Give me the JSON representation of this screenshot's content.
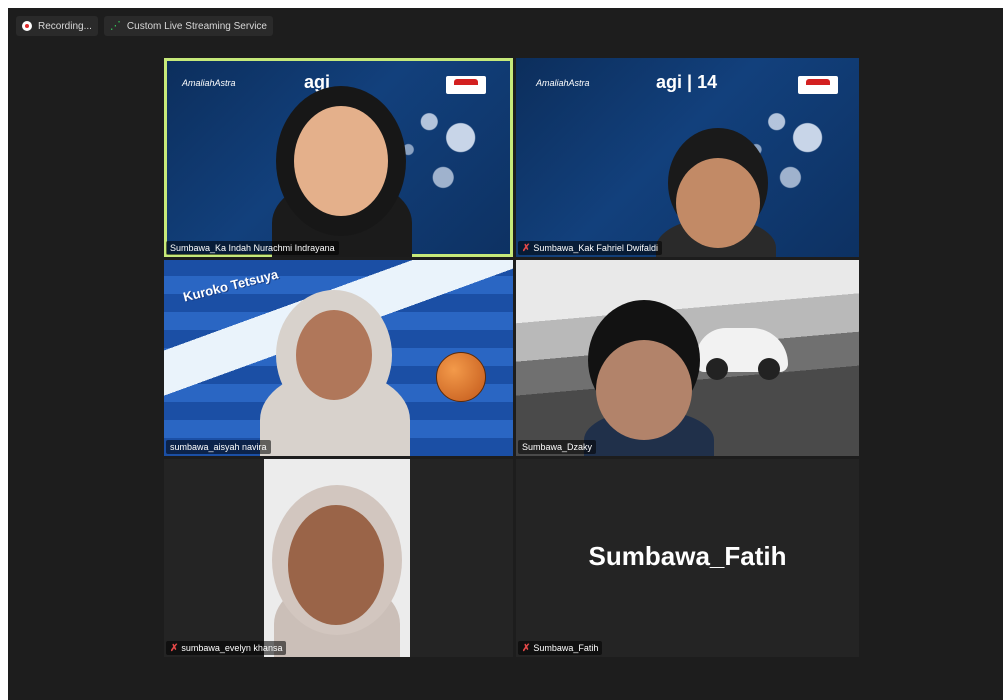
{
  "topbar": {
    "recording_label": "Recording...",
    "stream_label": "Custom Live Streaming Service"
  },
  "tiles": [
    {
      "name": "Sumbawa_Ka Indah Nurachmi Indrayana",
      "muted": false,
      "active": true
    },
    {
      "name": "Sumbawa_Kak Fahriel Dwifaldi",
      "muted": true,
      "active": false
    },
    {
      "name": "sumbawa_aisyah navira",
      "muted": false,
      "active": false
    },
    {
      "name": "Sumbawa_Dzaky",
      "muted": false,
      "active": false
    },
    {
      "name": "sumbawa_evelyn khansa",
      "muted": true,
      "active": false
    },
    {
      "name": "Sumbawa_Fatih",
      "muted": true,
      "active": false,
      "camera_off_name": "Sumbawa_Fatih"
    }
  ],
  "background_text": {
    "brand": "AmaliahAstra",
    "event": "agi",
    "event_number": "14",
    "anime_title": "Kuroko Tetsuya"
  },
  "colors": {
    "app_bg": "#1d1d1d",
    "active_speaker": "#c6e97a",
    "muted": "#e34848",
    "stream": "#34c759"
  }
}
